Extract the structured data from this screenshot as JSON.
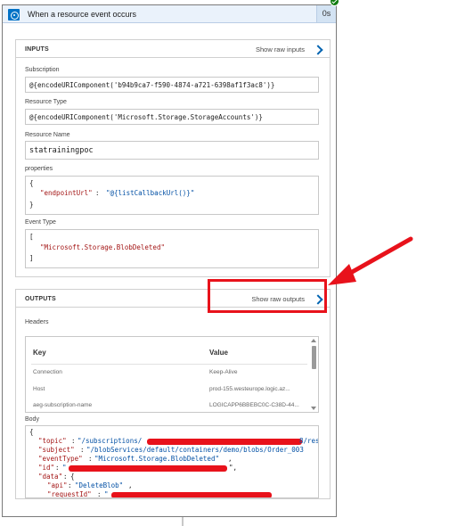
{
  "trigger": {
    "title": "When a resource event occurs",
    "duration": "0s",
    "status": "succeeded"
  },
  "inputs": {
    "section_title": "INPUTS",
    "raw_link": "Show raw inputs",
    "subscription": {
      "label": "Subscription",
      "value": "@{encodeURIComponent('b94b9ca7-f590-4874-a721-6398af1f3ac8')}"
    },
    "resource_type": {
      "label": "Resource Type",
      "value": "@{encodeURIComponent('Microsoft.Storage.StorageAccounts')}"
    },
    "resource_name": {
      "label": "Resource Name",
      "value": "statrainingpoc"
    },
    "properties": {
      "label": "properties",
      "open": "{",
      "key": "\"endpointUrl\"",
      "colon": ": ",
      "value": "\"@{listCallbackUrl()}\"",
      "close": "}"
    },
    "event_type": {
      "label": "Event Type",
      "open": "[",
      "value": "\"Microsoft.Storage.BlobDeleted\"",
      "close": "]"
    }
  },
  "outputs": {
    "section_title": "OUTPUTS",
    "raw_link": "Show raw outputs",
    "headers_label": "Headers",
    "headers_columns": {
      "key": "Key",
      "value": "Value"
    },
    "headers_rows": [
      {
        "key": "Connection",
        "value": "Keep-Alive"
      },
      {
        "key": "Host",
        "value": "prod-155.westeurope.logic.az..."
      },
      {
        "key": "aeg-subscription-name",
        "value": "LOGICAPP6BBEBC0C-C38D-44..."
      }
    ],
    "body_label": "Body",
    "body_lines": {
      "open": "{",
      "topic_key": "\"topic\"",
      "topic_val_start": "\"/subscriptions/",
      "topic_val_end": "8/res",
      "subject_key": "\"subject\"",
      "subject_val": "\"/blobServices/default/containers/demo/blobs/Order_003",
      "eventtype_key": "\"eventType\"",
      "eventtype_val": "\"Microsoft.Storage.BlobDeleted\"",
      "id_key": "\"id\"",
      "id_val": "\"",
      "data_key": "\"data\"",
      "data_open": "{",
      "api_key": "\"api\"",
      "api_val": "\"DeleteBlob\"",
      "requestid_key": "\"requestId\"",
      "requestid_val": "\""
    }
  },
  "colors": {
    "accent": "#0072c6",
    "success": "#107c10",
    "annotation": "#e8121b",
    "json_key": "#a31515",
    "json_string": "#0451a5"
  }
}
